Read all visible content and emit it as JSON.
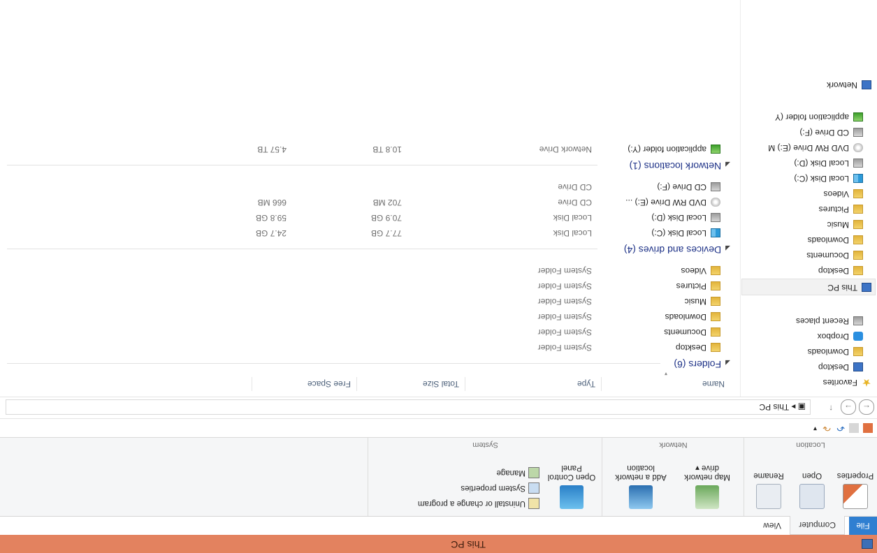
{
  "window": {
    "title": "This PC"
  },
  "tabs": [
    "File",
    "Computer",
    "View"
  ],
  "ribbon": {
    "groups": [
      {
        "label": "Location",
        "buttons": [
          "Properties",
          "Open",
          "Rename"
        ]
      },
      {
        "label": "Network",
        "buttons": [
          "Map network drive",
          "Add a network location"
        ]
      },
      {
        "label": "System",
        "big": "Open Control Panel",
        "small": [
          "Uninstall or change a program",
          "System properties",
          "Manage"
        ]
      }
    ]
  },
  "address": {
    "crumb": "This PC"
  },
  "columns": {
    "name": "Name",
    "type": "Type",
    "total": "Total Size",
    "free": "Free Space"
  },
  "nav": {
    "favorites": "Favorites",
    "fav_items": [
      "Desktop",
      "Downloads",
      "Dropbox",
      "Recent places"
    ],
    "thispc": "This PC",
    "pc_items": [
      "Desktop",
      "Documents",
      "Downloads",
      "Music",
      "Pictures",
      "Videos",
      "Local Disk (C:)",
      "Local Disk (D:)",
      "DVD RW Drive (E:) M",
      "CD Drive (F:)",
      "application folder (Y"
    ],
    "network": "Network"
  },
  "folders": {
    "header": "Folders (6)",
    "rows": [
      {
        "name": "Desktop",
        "type": "System Folder"
      },
      {
        "name": "Documents",
        "type": "System Folder"
      },
      {
        "name": "Downloads",
        "type": "System Folder"
      },
      {
        "name": "Music",
        "type": "System Folder"
      },
      {
        "name": "Pictures",
        "type": "System Folder"
      },
      {
        "name": "Videos",
        "type": "System Folder"
      }
    ]
  },
  "devices": {
    "header": "Devices and drives (4)",
    "rows": [
      {
        "name": "Local Disk (C:)",
        "type": "Local Disk",
        "total": "77.7 GB",
        "free": "24.7 GB"
      },
      {
        "name": "Local Disk (D:)",
        "type": "Local Disk",
        "total": "70.9 GB",
        "free": "59.8 GB"
      },
      {
        "name": "DVD RW Drive (E:) ...",
        "type": "CD Drive",
        "total": "702 MB",
        "free": "666 MB"
      },
      {
        "name": "CD Drive (F:)",
        "type": "CD Drive",
        "total": "",
        "free": ""
      }
    ]
  },
  "network": {
    "header": "Network locations (1)",
    "rows": [
      {
        "name": "application folder (Y:)",
        "type": "Network Drive",
        "total": "10.8 TB",
        "free": "4.57 TB"
      }
    ]
  }
}
